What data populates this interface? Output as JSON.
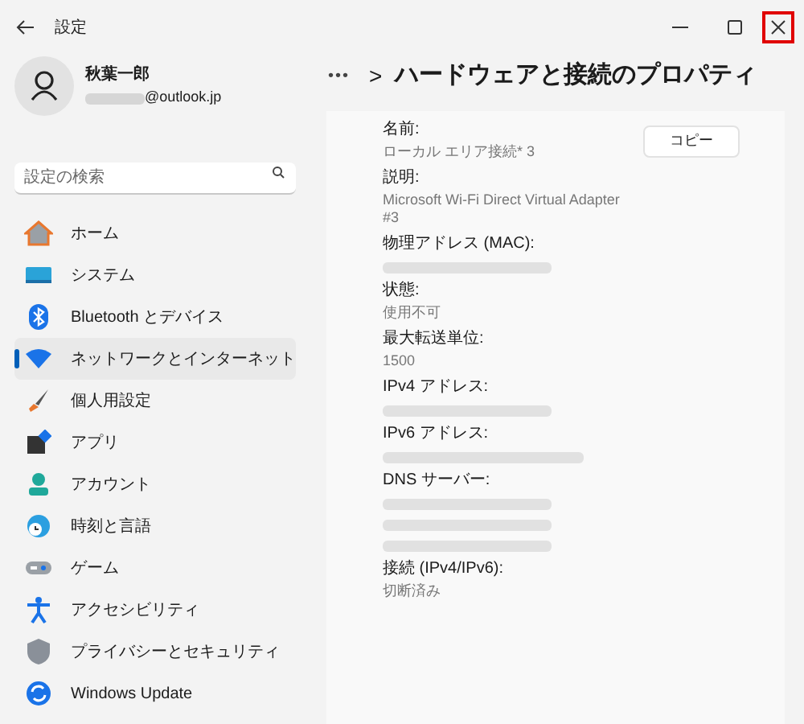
{
  "window": {
    "title": "設定",
    "close_highlighted": true
  },
  "account": {
    "name": "秋葉一郎",
    "email_suffix": "@outlook.jp"
  },
  "search": {
    "placeholder": "設定の検索"
  },
  "sidebar": {
    "items": [
      {
        "label": "ホーム",
        "selected": false
      },
      {
        "label": "システム",
        "selected": false
      },
      {
        "label": "Bluetooth とデバイス",
        "selected": false
      },
      {
        "label": "ネットワークとインターネット",
        "selected": true
      },
      {
        "label": "個人用設定",
        "selected": false
      },
      {
        "label": "アプリ",
        "selected": false
      },
      {
        "label": "アカウント",
        "selected": false
      },
      {
        "label": "時刻と言語",
        "selected": false
      },
      {
        "label": "ゲーム",
        "selected": false
      },
      {
        "label": "アクセシビリティ",
        "selected": false
      },
      {
        "label": "プライバシーとセキュリティ",
        "selected": false
      },
      {
        "label": "Windows Update",
        "selected": false
      }
    ]
  },
  "breadcrumb": {
    "ellipsis": "•••",
    "chevron": ">",
    "title": "ハードウェアと接続のプロパティ"
  },
  "copy_button": "コピー",
  "properties": [
    {
      "label": "名前:",
      "values": [
        {
          "kind": "text",
          "text": "ローカル エリア接続* 3"
        }
      ]
    },
    {
      "label": "説明:",
      "values": [
        {
          "kind": "text",
          "text": "Microsoft Wi-Fi Direct Virtual Adapter #3"
        }
      ]
    },
    {
      "label": "物理アドレス (MAC):",
      "values": [
        {
          "kind": "blurred"
        }
      ]
    },
    {
      "label": "状態:",
      "values": [
        {
          "kind": "text",
          "text": "使用不可"
        }
      ]
    },
    {
      "label": "最大転送単位:",
      "values": [
        {
          "kind": "text",
          "text": "1500"
        }
      ]
    },
    {
      "label": "IPv4 アドレス:",
      "values": [
        {
          "kind": "blurred"
        }
      ]
    },
    {
      "label": "IPv6 アドレス:",
      "values": [
        {
          "kind": "blurred_long"
        }
      ]
    },
    {
      "label": "DNS サーバー:",
      "values": [
        {
          "kind": "blurred"
        },
        {
          "kind": "blurred"
        },
        {
          "kind": "blurred"
        }
      ]
    },
    {
      "label": "接続 (IPv4/IPv6):",
      "values": [
        {
          "kind": "text",
          "text": "切断済み"
        }
      ]
    }
  ]
}
